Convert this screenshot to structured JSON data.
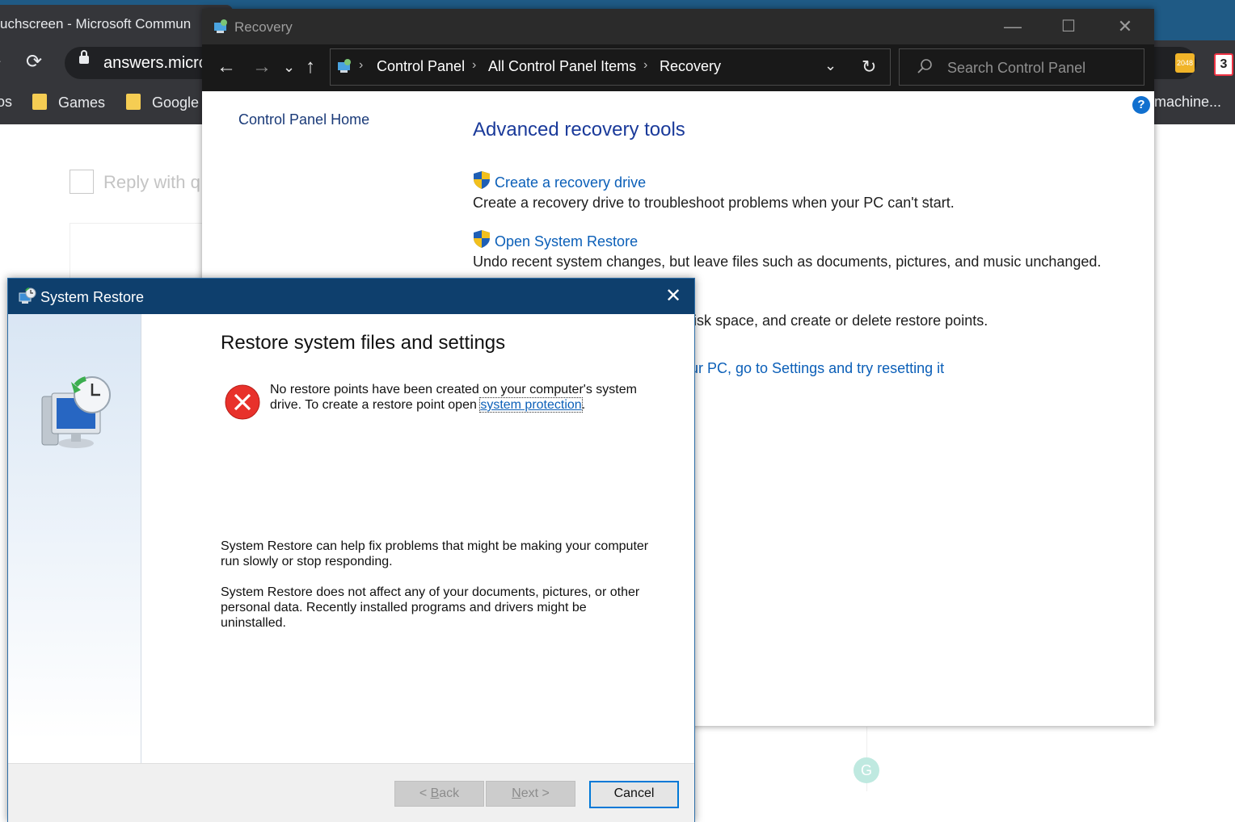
{
  "browser": {
    "tab_title": "uchscreen - Microsoft Commun",
    "url": "answers.micro",
    "bookmarks": [
      {
        "label": "os"
      },
      {
        "label": "Games"
      },
      {
        "label": "Google"
      }
    ],
    "right_bookmark": "machine...",
    "extensions": [
      "2048",
      "3"
    ],
    "reply_placeholder": "Reply with q"
  },
  "control_panel": {
    "window_title": "Recovery",
    "breadcrumb": [
      "Control Panel",
      "All Control Panel Items",
      "Recovery"
    ],
    "search_placeholder": "Search Control Panel",
    "left_link": "Control Panel Home",
    "heading": "Advanced recovery tools",
    "items": [
      {
        "link": "Create a recovery drive",
        "desc": "Create a recovery drive to troubleshoot problems when your PC can't start."
      },
      {
        "link": "Open System Restore",
        "desc": "Undo recent system changes, but leave files such as documents, pictures, and music unchanged."
      },
      {
        "desc": "lisk space, and create or delete restore points."
      }
    ],
    "partial_link": "ur PC, go to Settings and try resetting it",
    "help_glyph": "?"
  },
  "system_restore": {
    "window_title": "System Restore",
    "heading": "Restore system files and settings",
    "error_text_before": "No restore points have been created on your computer's system drive. To create a restore point open ",
    "error_link": "system protection",
    "error_text_after": ".",
    "paragraph1": "System Restore can help fix problems that might be making your computer run slowly or stop responding.",
    "paragraph2": "System Restore does not affect any of your documents, pictures, or other personal data. Recently installed programs and drivers might be uninstalled.",
    "buttons": {
      "back_prefix": "< ",
      "back_accel": "B",
      "back_rest": "ack",
      "next_accel": "N",
      "next_rest": "ext >",
      "cancel": "Cancel"
    }
  },
  "colors": {
    "dialog_titlebar": "#0e3f6d",
    "link": "#0b5fb8",
    "heading_blue": "#1a3a9a",
    "error_red": "#e8312b"
  }
}
